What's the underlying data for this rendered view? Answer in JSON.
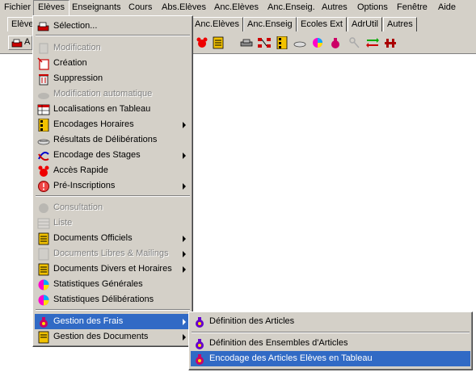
{
  "menubar": {
    "items": [
      "Fichier",
      "Elèves",
      "Enseignants",
      "Cours",
      "Abs.Elèves",
      "Anc.Elèves",
      "Anc.Enseig.",
      "Autres",
      "Options",
      "Fenêtre",
      "Aide"
    ]
  },
  "tabs": [
    "Elève",
    "Anc.Elèves",
    "Anc.Enseig",
    "Ecoles Ext",
    "AdrUtil",
    "Autres"
  ],
  "toolbar": {
    "first_button_label": "A"
  },
  "eleves_menu": {
    "items": [
      {
        "label": "Sélection...",
        "icon": "selection-icon",
        "enabled": true,
        "submenu": false
      },
      {
        "label": "Modification",
        "icon": "modification-icon",
        "enabled": false,
        "submenu": false
      },
      {
        "label": "Création",
        "icon": "creation-icon",
        "enabled": true,
        "submenu": false
      },
      {
        "label": "Suppression",
        "icon": "suppression-icon",
        "enabled": true,
        "submenu": false
      },
      {
        "label": "Modification automatique",
        "icon": "auto-modification-icon",
        "enabled": false,
        "submenu": false
      },
      {
        "label": "Localisations en Tableau",
        "icon": "table-icon",
        "enabled": true,
        "submenu": false
      },
      {
        "label": "Encodages Horaires",
        "icon": "schedule-icon",
        "enabled": true,
        "submenu": true
      },
      {
        "label": "Résultats de Délibérations",
        "icon": "results-icon",
        "enabled": true,
        "submenu": false
      },
      {
        "label": "Encodage des Stages",
        "icon": "stages-icon",
        "enabled": true,
        "submenu": true
      },
      {
        "label": "Accès Rapide",
        "icon": "quick-access-icon",
        "enabled": true,
        "submenu": false
      },
      {
        "label": "Pré-Inscriptions",
        "icon": "pre-registration-icon",
        "enabled": true,
        "submenu": true
      },
      {
        "label": "Consultation",
        "icon": "consultation-icon",
        "enabled": false,
        "submenu": false
      },
      {
        "label": "Liste",
        "icon": "list-icon",
        "enabled": false,
        "submenu": false
      },
      {
        "label": "Documents Officiels",
        "icon": "documents-icon",
        "enabled": true,
        "submenu": true
      },
      {
        "label": "Documents Libres  & Mailings",
        "icon": "mailing-icon",
        "enabled": false,
        "submenu": true
      },
      {
        "label": "Documents Divers et Horaires",
        "icon": "documents-divers-icon",
        "enabled": true,
        "submenu": true
      },
      {
        "label": "Statistiques Générales",
        "icon": "pie-chart-icon",
        "enabled": true,
        "submenu": false
      },
      {
        "label": "Statistiques Délibérations",
        "icon": "pie-chart-icon",
        "enabled": true,
        "submenu": false
      },
      {
        "label": "Gestion des Frais",
        "icon": "money-bag-icon",
        "enabled": true,
        "submenu": true,
        "highlighted": true
      },
      {
        "label": "Gestion des Documents",
        "icon": "document-management-icon",
        "enabled": true,
        "submenu": true
      }
    ]
  },
  "frais_submenu": {
    "items": [
      {
        "label": "Définition des Articles",
        "icon": "money-bag-icon"
      },
      {
        "label": "Définition des Ensembles d'Articles",
        "icon": "money-bag-icon"
      },
      {
        "label": "Encodage des Articles Elèves en Tableau",
        "icon": "money-bag-icon",
        "highlighted": true
      }
    ]
  },
  "colors": {
    "face": "#d4d0c8",
    "highlight": "#316ac5",
    "disabled_text": "#808080"
  }
}
